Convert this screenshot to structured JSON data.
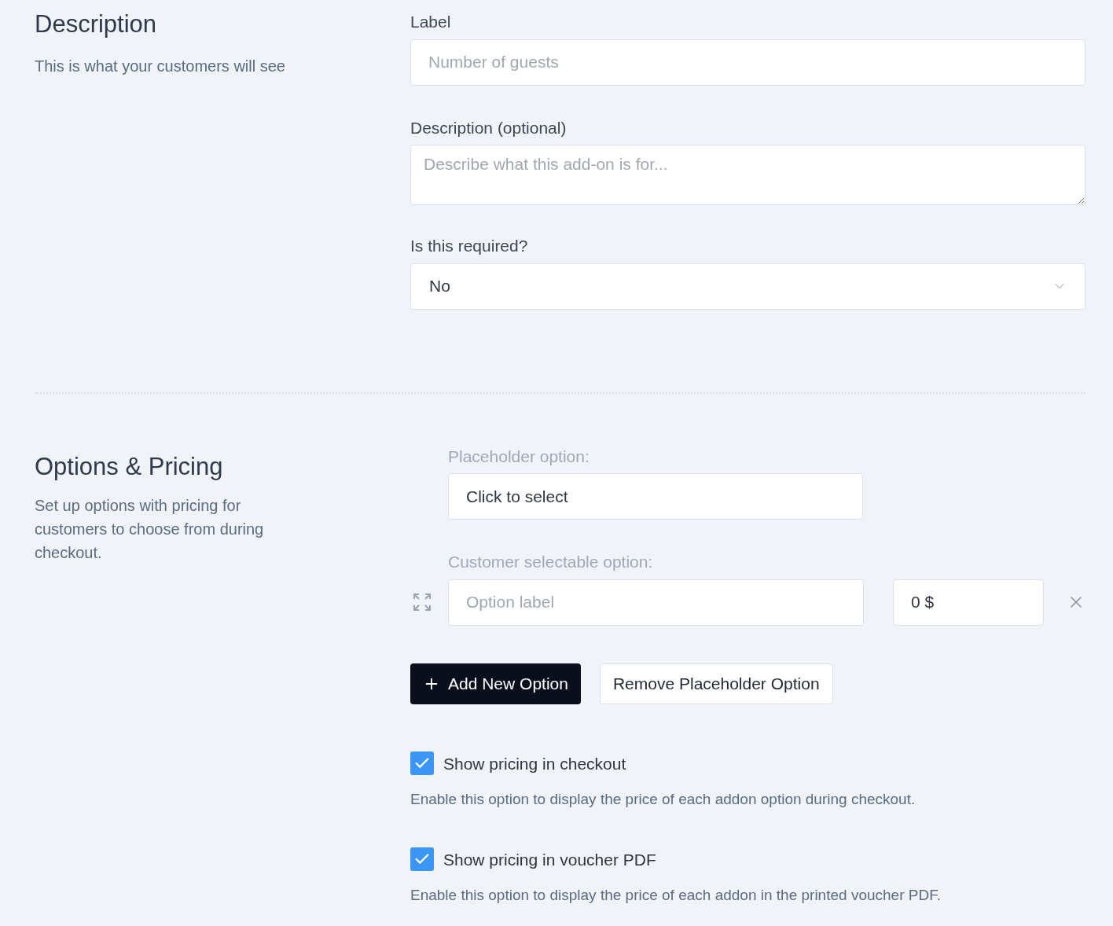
{
  "description_section": {
    "title": "Description",
    "subtitle": "This is what your customers will see"
  },
  "label_field": {
    "label": "Label",
    "placeholder": "Number of guests"
  },
  "description_field": {
    "label": "Description (optional)",
    "placeholder": "Describe what this add-on is for..."
  },
  "required_field": {
    "label": "Is this required?",
    "value": "No"
  },
  "options_section": {
    "title": "Options & Pricing",
    "subtitle": "Set up options with pricing for customers to choose from during checkout."
  },
  "placeholder_option": {
    "label": "Placeholder option:",
    "value": "Click to select"
  },
  "customer_option": {
    "label": "Customer selectable option:",
    "placeholder": "Option label",
    "price": "0 $"
  },
  "buttons": [
    {
      "kind": "primary",
      "label": "Add New Option"
    },
    {
      "kind": "secondary",
      "label": "Remove Placeholder Option"
    }
  ],
  "settings": [
    {
      "label": "Show pricing in checkout",
      "checked": true,
      "help": "Enable this option to display the price of each addon option during checkout."
    },
    {
      "label": "Show pricing in voucher PDF",
      "checked": true,
      "help": "Enable this option to display the price of each addon in the printed voucher PDF."
    }
  ]
}
